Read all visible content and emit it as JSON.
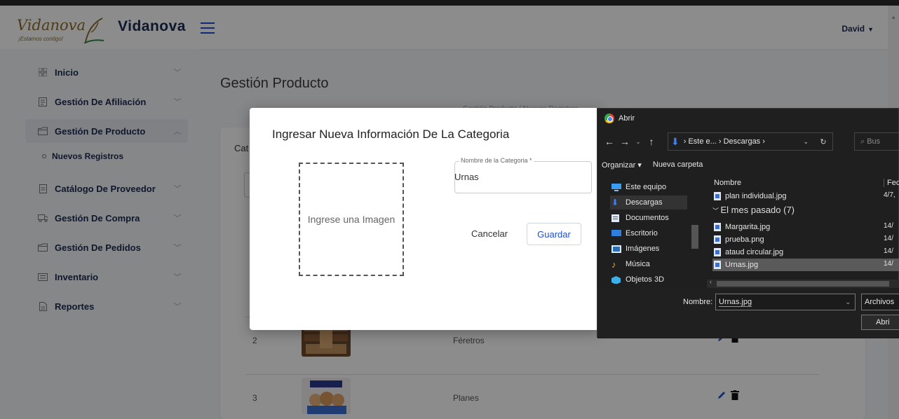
{
  "header": {
    "logo_script": "Vidanova",
    "logo_tagline": "¡Estamos contigo!",
    "brand": "Vidanova",
    "user": "David"
  },
  "sidebar": {
    "items": [
      {
        "label": "Inicio",
        "icon": "grid-icon"
      },
      {
        "label": "Gestión De Afiliación",
        "icon": "form-icon"
      },
      {
        "label": "Gestión De Producto",
        "icon": "folder-icon"
      },
      {
        "label": "Catálogo De Proveedor",
        "icon": "doc-icon"
      },
      {
        "label": "Gestión De Compra",
        "icon": "truck-icon"
      },
      {
        "label": "Gestión De Pedidos",
        "icon": "folder-icon"
      },
      {
        "label": "Inventario",
        "icon": "list-icon"
      },
      {
        "label": "Reportes",
        "icon": "doc-icon"
      }
    ],
    "sub_item": "Nuevos Registros"
  },
  "main": {
    "page_title": "Gestión Producto",
    "breadcrumb": "Gestión Producto / Nuevos Registros",
    "card_title": "Cat",
    "rows": [
      {
        "num": "2",
        "name": "Féretros"
      },
      {
        "num": "3",
        "name": "Planes"
      }
    ]
  },
  "modal": {
    "title": "Ingresar Nueva Información De La Categoria",
    "drop_text": "Ingrese una Imagen",
    "field_label": "Nombre de la Categoria *",
    "field_value": "Urnas",
    "cancel": "Cancelar",
    "save": "Guardar"
  },
  "file_dialog": {
    "title": "Abrir",
    "address": [
      "Este e...",
      "Descargas"
    ],
    "search_placeholder": "Bus",
    "organize": "Organizar ▾",
    "new_folder": "Nueva carpeta",
    "nav_items": [
      "Este equipo",
      "Descargas",
      "Documentos",
      "Escritorio",
      "Imágenes",
      "Música",
      "Objetos 3D"
    ],
    "col_name": "Nombre",
    "col_date": "Fec",
    "group_label": "El mes pasado (7)",
    "files": [
      {
        "name": "plan individual.jpg",
        "date": "4/7,"
      },
      {
        "name": "Margarita.jpg",
        "date": "14/"
      },
      {
        "name": "prueba.png",
        "date": "14/"
      },
      {
        "name": "ataud circular.jpg",
        "date": "14/"
      },
      {
        "name": "Urnas.jpg",
        "date": "14/"
      }
    ],
    "name_label": "Nombre:",
    "name_value": "Urnas.jpg",
    "type_value": "Archivos",
    "open_button": "Abri"
  },
  "colors": {
    "accent": "#1e4fd1",
    "brand_text": "#1a2a52",
    "overlay": "#000000"
  }
}
